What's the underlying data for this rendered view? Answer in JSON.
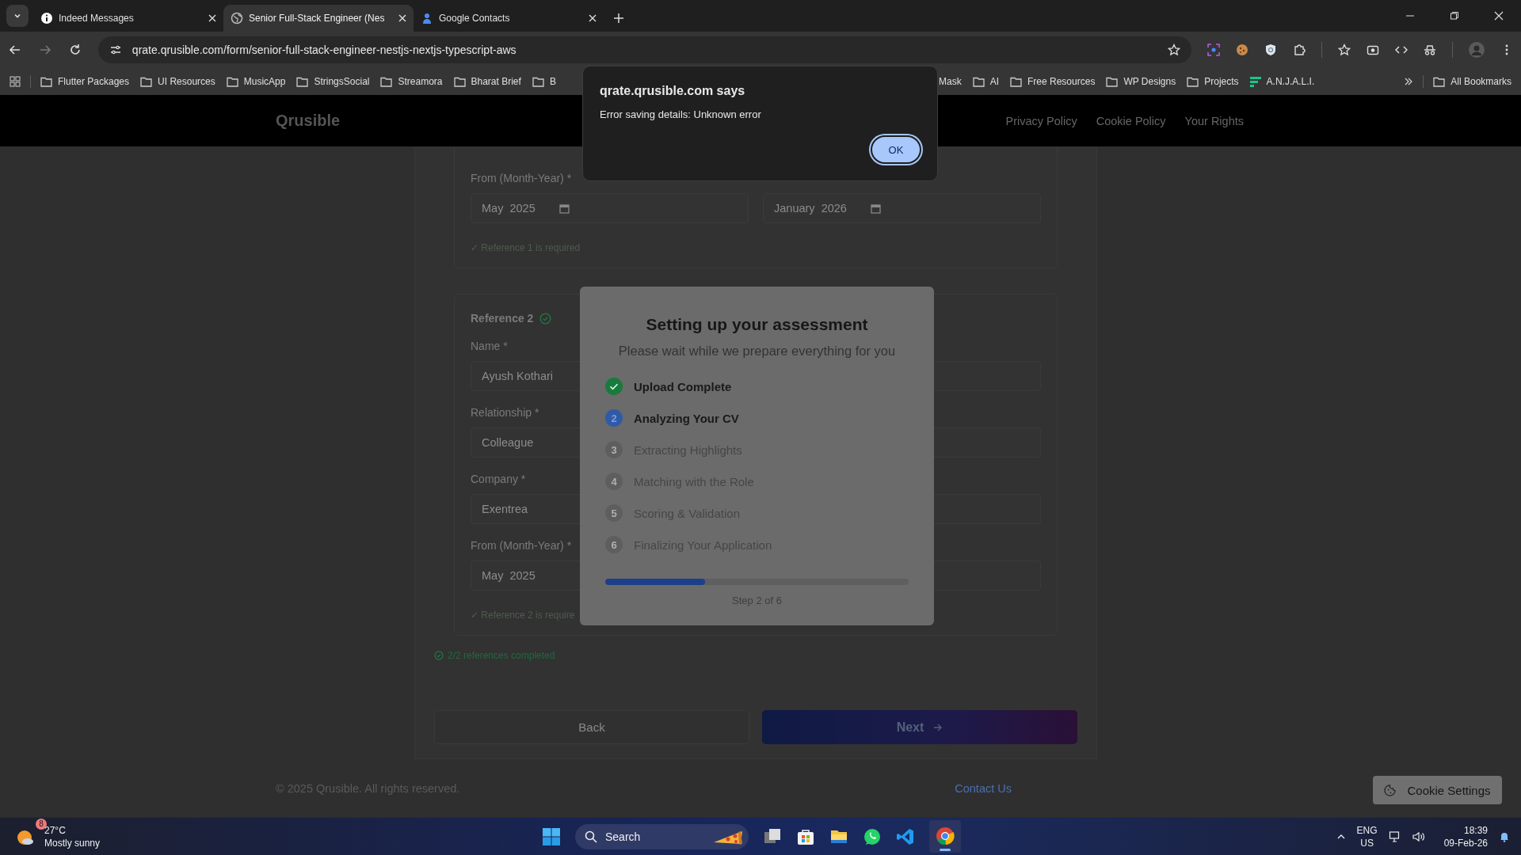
{
  "browser": {
    "tabs": [
      {
        "title": "Indeed Messages",
        "selected": false
      },
      {
        "title": "Senior Full-Stack Engineer (Nes",
        "selected": true
      },
      {
        "title": "Google Contacts",
        "selected": false
      }
    ],
    "address": "qrate.qrusible.com/form/senior-full-stack-engineer-nestjs-nextjs-typescript-aws",
    "bookmarks_left": [
      {
        "label": "Flutter Packages",
        "kind": "folder"
      },
      {
        "label": "UI Resources",
        "kind": "folder"
      },
      {
        "label": "MusicApp",
        "kind": "folder"
      },
      {
        "label": "StringsSocial",
        "kind": "folder"
      },
      {
        "label": "Streamora",
        "kind": "folder"
      },
      {
        "label": "Bharat Brief",
        "kind": "folder"
      },
      {
        "label": "B",
        "kind": "folder"
      }
    ],
    "bookmarks_right": [
      {
        "label": "Mask",
        "kind": "bare"
      },
      {
        "label": "AI",
        "kind": "folder"
      },
      {
        "label": "Free Resources",
        "kind": "folder"
      },
      {
        "label": "WP Designs",
        "kind": "folder"
      },
      {
        "label": "Projects",
        "kind": "folder"
      },
      {
        "label": "A.N.J.A.L.I.",
        "kind": "app"
      }
    ],
    "all_bookmarks": "All Bookmarks"
  },
  "alert": {
    "title": "qrate.qrusible.com says",
    "message": "Error saving details: Unknown error",
    "button": "OK"
  },
  "site_header": {
    "logo": "Qrusible",
    "links": [
      "Privacy Policy",
      "Cookie Policy",
      "Your Rights"
    ]
  },
  "reference_1": {
    "from_label": "From (Month-Year) *",
    "from_value": "May  2025",
    "to_value": "January  2026",
    "status": "✓ Reference 1 is required"
  },
  "reference_2": {
    "title": "Reference 2",
    "complete": true,
    "fields": [
      {
        "label": "Name *",
        "value": "Ayush Kothari"
      },
      {
        "label": "Relationship *",
        "value": "Colleague"
      },
      {
        "label": "Company *",
        "value": "Exentrea"
      },
      {
        "label": "From (Month-Year) *",
        "value": "May  2025"
      }
    ],
    "status": "✓ Reference 2 is require"
  },
  "progress_note": "2/2 references completed",
  "buttons": {
    "back": "Back",
    "next": "Next"
  },
  "footer": {
    "copyright": "© 2025 Qrusible. All rights reserved.",
    "contact": "Contact Us"
  },
  "cookie_button": "Cookie Settings",
  "modal": {
    "title": "Setting up your assessment",
    "subtitle": "Please wait while we prepare everything for you",
    "steps": [
      {
        "label": "Upload Complete",
        "done": true,
        "active": false
      },
      {
        "label": "Analyzing Your CV",
        "done": false,
        "active": true,
        "number": "2"
      },
      {
        "label": "Extracting Highlights",
        "done": false,
        "active": false,
        "number": "3"
      },
      {
        "label": "Matching with the Role",
        "done": false,
        "active": false,
        "number": "4"
      },
      {
        "label": "Scoring & Validation",
        "done": false,
        "active": false,
        "number": "5"
      },
      {
        "label": "Finalizing Your Application",
        "done": false,
        "active": false,
        "number": "6"
      }
    ],
    "level": 0.33,
    "step_text": "Step 2 of 6"
  },
  "taskbar": {
    "weather_badge": "8",
    "temperature": "27°C",
    "weather": "Mostly sunny",
    "search": "Search",
    "lang": "ENG",
    "region": "US",
    "time": "18:39",
    "date": "09-Feb-26"
  }
}
